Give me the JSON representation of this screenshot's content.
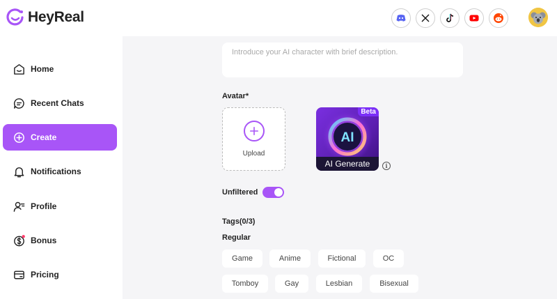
{
  "header": {
    "brand": "HeyReal",
    "socials": [
      {
        "name": "discord-icon",
        "color": "#5865f2"
      },
      {
        "name": "x-icon",
        "color": "#111111"
      },
      {
        "name": "tiktok-icon",
        "color": "#111111"
      },
      {
        "name": "youtube-icon",
        "color": "#ff0000"
      },
      {
        "name": "reddit-icon",
        "color": "#ff4500"
      }
    ]
  },
  "sidebar": {
    "items": [
      {
        "label": "Home",
        "icon": "home-icon"
      },
      {
        "label": "Recent Chats",
        "icon": "chat-icon"
      },
      {
        "label": "Create",
        "icon": "plus-circle-icon",
        "active": true
      },
      {
        "label": "Notifications",
        "icon": "bell-icon"
      },
      {
        "label": "Profile",
        "icon": "profile-icon"
      },
      {
        "label": "Bonus",
        "icon": "dollar-icon"
      },
      {
        "label": "Pricing",
        "icon": "card-icon"
      }
    ]
  },
  "form": {
    "description_placeholder": "Introduce your AI character with brief description.",
    "avatar_label": "Avatar*",
    "upload_label": "Upload",
    "ai_badge": "Beta",
    "ai_logo": "AI",
    "ai_label": "AI Generate",
    "info_glyph": "i",
    "unfiltered_label": "Unfiltered",
    "unfiltered_on": true,
    "tags_label": "Tags(0/3)",
    "regular_label": "Regular",
    "tags_row1": [
      "Game",
      "Anime",
      "Fictional",
      "OC"
    ],
    "tags_row2": [
      "Tomboy",
      "Gay",
      "Lesbian",
      "Bisexual"
    ]
  },
  "colors": {
    "accent": "#a855f7",
    "background": "#f5f5f7"
  }
}
